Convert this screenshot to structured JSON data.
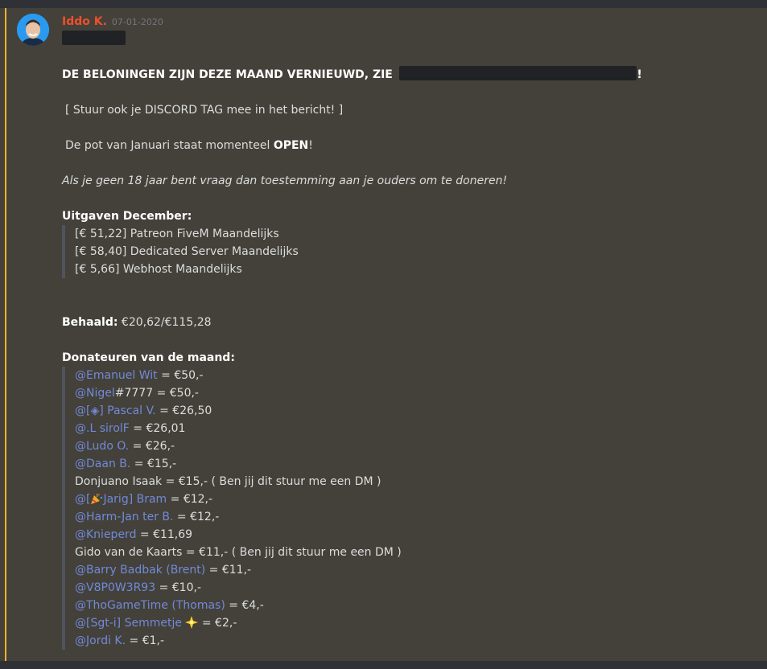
{
  "author": {
    "name": "Iddo K.",
    "timestamp": "07-01-2020"
  },
  "colors": {
    "username": "#f04f2b",
    "mention": "#7289da",
    "accent": "#f0b232",
    "background": "#434139"
  },
  "headline": {
    "text": "DE BELONINGEN ZIJN DEZE MAAND VERNIEUWD, ZIE",
    "suffix": "!"
  },
  "discord_tag_note": "[ Stuur ook je DISCORD TAG mee in het bericht! ]",
  "pot": {
    "prefix": "De pot van Januari staat momenteel",
    "status": "OPEN",
    "suffix": "!"
  },
  "age_note": "Als je geen 18 jaar bent vraag dan toestemming aan je ouders om te doneren!",
  "expenses": {
    "title": "Uitgaven December:",
    "items": [
      "[€ 51,22] Patreon FiveM Maandelijks",
      "[€ 58,40] Dedicated Server Maandelijks",
      "[€ 5,66] Webhost Maandelijks"
    ]
  },
  "achieved": {
    "label": "Behaald:",
    "value": "€20,62/€115,28"
  },
  "donors": {
    "title": "Donateuren van de maand:",
    "items": [
      {
        "mention": "@Emanuel Wit",
        "text": " = €50,-"
      },
      {
        "mention": "@Nigel",
        "text": "#7777 = €50,-"
      },
      {
        "mention": "@[◈] Pascal V.",
        "text": " = €26,50"
      },
      {
        "mention": "@.L sirolF",
        "text": " = €26,01"
      },
      {
        "mention": "@Ludo O.",
        "text": " = €26,-"
      },
      {
        "mention": "@Daan B.",
        "text": " = €15,-"
      },
      {
        "mention": "",
        "text": "Donjuano Isaak = €15,- ( Ben jij dit stuur me een DM )"
      },
      {
        "mention_prefix": "@[",
        "emoji": "party-popper-icon",
        "mention": "Jarig] Bram",
        "text": " = €12,-"
      },
      {
        "mention": "@Harm-Jan ter B.",
        "text": " = €12,-"
      },
      {
        "mention": "@Knieperd",
        "text": " = €11,69"
      },
      {
        "mention": "",
        "text": "Gido van de Kaarts = €11,- ( Ben jij dit stuur me een DM )"
      },
      {
        "mention": "@Barry Badbak (Brent)",
        "text": " = €11,-"
      },
      {
        "mention": "@V8P0W3R93",
        "text": " = €10,-"
      },
      {
        "mention": "@ThoGameTime (Thomas)",
        "text": " = €4,-"
      },
      {
        "mention": "@[Sgt-i] Semmetje",
        "emoji": "sparkle-star-icon",
        "text": " = €2,-"
      },
      {
        "mention": "@Jordi K.",
        "text": " = €1,-"
      }
    ]
  }
}
